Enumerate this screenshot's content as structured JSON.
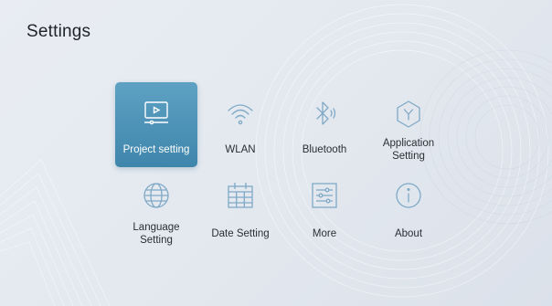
{
  "header": {
    "title": "Settings"
  },
  "colors": {
    "accent": "#4a90b8",
    "icon_stroke": "#7fa9c6",
    "background": "#e6eaf0"
  },
  "tiles": [
    {
      "label": "Project setting",
      "icon": "projector-icon",
      "active": true
    },
    {
      "label": "WLAN",
      "icon": "wifi-icon",
      "active": false
    },
    {
      "label": "Bluetooth",
      "icon": "bluetooth-icon",
      "active": false
    },
    {
      "label": "Application\nSetting",
      "icon": "app-hexagon-icon",
      "active": false
    },
    {
      "label": "Language\nSetting",
      "icon": "globe-icon",
      "active": false
    },
    {
      "label": "Date Setting",
      "icon": "calendar-icon",
      "active": false
    },
    {
      "label": "More",
      "icon": "sliders-icon",
      "active": false
    },
    {
      "label": "About",
      "icon": "info-icon",
      "active": false
    }
  ]
}
